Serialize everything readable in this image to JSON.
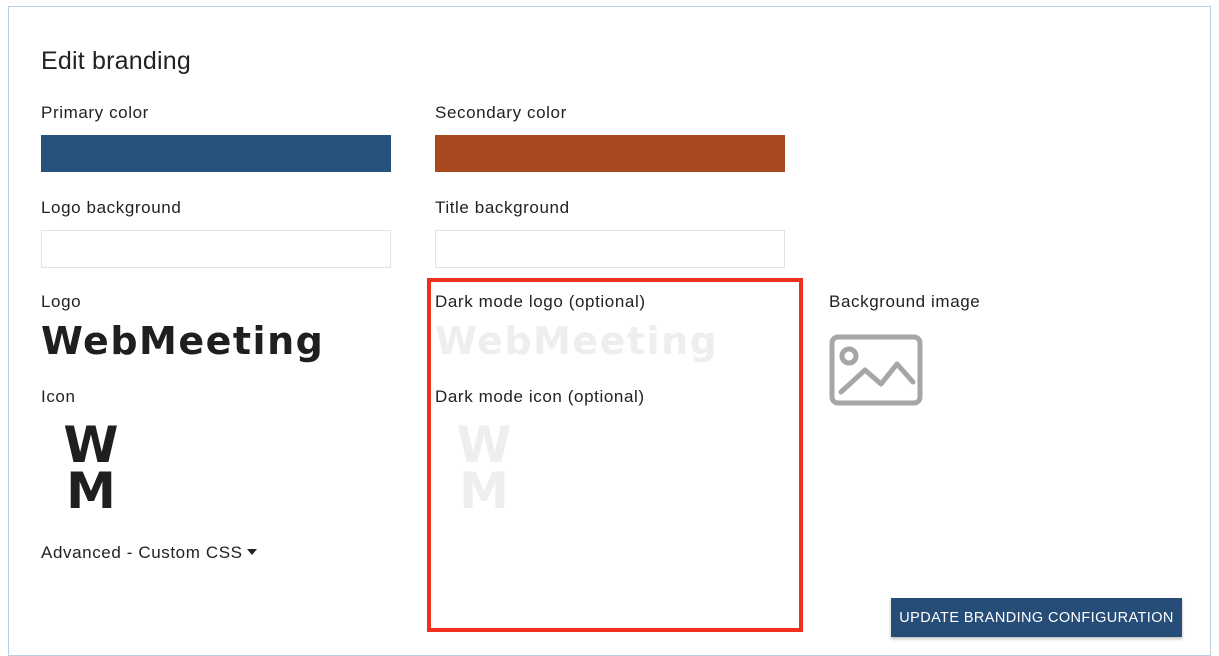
{
  "page": {
    "title": "Edit branding"
  },
  "colors": {
    "primary_label": "Primary color",
    "primary_value": "#27527b",
    "secondary_label": "Secondary color",
    "secondary_value": "#a8491f",
    "highlight": "#f0301e",
    "button_bg": "#254d78"
  },
  "backgrounds": {
    "logo_label": "Logo background",
    "logo_value": "",
    "title_label": "Title background",
    "title_value": ""
  },
  "images": {
    "logo_label": "Logo",
    "logo_text": "WebMeeting",
    "dark_logo_label": "Dark mode logo (optional)",
    "dark_logo_text": "WebMeeting",
    "background_image_label": "Background image",
    "background_image_icon": "image-placeholder-icon",
    "icon_label": "Icon",
    "icon_line1": "W",
    "icon_line2": "M",
    "dark_icon_label": "Dark mode icon (optional)",
    "dark_icon_line1": "W",
    "dark_icon_line2": "M"
  },
  "advanced": {
    "label": "Advanced - Custom CSS",
    "icon": "caret-down-icon"
  },
  "actions": {
    "update_label": "UPDATE BRANDING CONFIGURATION"
  }
}
